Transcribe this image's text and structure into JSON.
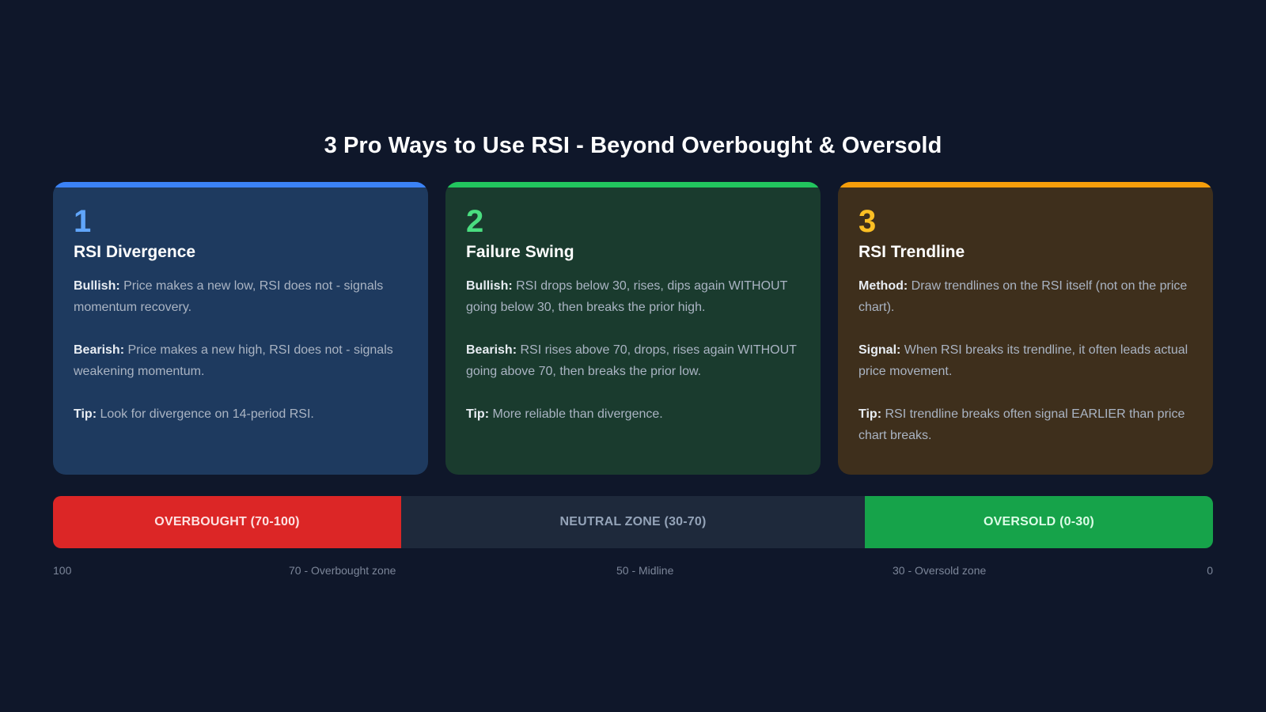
{
  "title": "3 Pro Ways to Use RSI - Beyond Overbought & Oversold",
  "cards": [
    {
      "number": "1",
      "name": "RSI Divergence",
      "accent": "#3b82f6",
      "paragraphs": [
        {
          "label": "Bullish:",
          "text": "Price makes a new low, RSI does not - signals momentum recovery."
        },
        {
          "label": "Bearish:",
          "text": "Price makes a new high, RSI does not - signals weakening momentum."
        },
        {
          "label": "Tip:",
          "text": "Look for divergence on 14-period RSI."
        }
      ]
    },
    {
      "number": "2",
      "name": "Failure Swing",
      "accent": "#22c55e",
      "paragraphs": [
        {
          "label": "Bullish:",
          "text": "RSI drops below 30, rises, dips again WITHOUT going below 30, then breaks the prior high."
        },
        {
          "label": "Bearish:",
          "text": "RSI rises above 70, drops, rises again WITHOUT going above 70, then breaks the prior low."
        },
        {
          "label": "Tip:",
          "text": "More reliable than divergence."
        }
      ]
    },
    {
      "number": "3",
      "name": "RSI Trendline",
      "accent": "#f59e0b",
      "paragraphs": [
        {
          "label": "Method:",
          "text": "Draw trendlines on the RSI itself (not on the price chart)."
        },
        {
          "label": "Signal:",
          "text": "When RSI breaks its trendline, it often leads actual price movement."
        },
        {
          "label": "Tip:",
          "text": "RSI trendline breaks often signal EARLIER than price chart breaks."
        }
      ]
    }
  ],
  "zones": {
    "overbought": "OVERBOUGHT (70-100)",
    "neutral": "NEUTRAL ZONE (30-70)",
    "oversold": "OVERSOLD (0-30)"
  },
  "scale": [
    "100",
    "70 - Overbought zone",
    "50 - Midline",
    "30 - Oversold zone",
    "0"
  ]
}
